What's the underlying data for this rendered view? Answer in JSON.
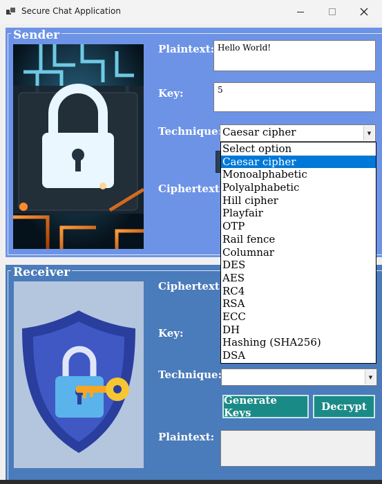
{
  "window": {
    "title": "Secure Chat Application"
  },
  "colors": {
    "sender_bg": "#6d93e6",
    "receiver_bg": "#4a7bba",
    "button_bg": "#1a8a86",
    "selection": "#0078d7"
  },
  "sender": {
    "group_title": "Sender",
    "plaintext_label": "Plaintext:",
    "plaintext_value": "Hello World!",
    "key_label": "Key:",
    "key_value": "5",
    "technique_label": "Technique:",
    "technique_value": "Caesar cipher",
    "ciphertext_label": "Ciphertext:",
    "image_icon": "padlock-circuit-image"
  },
  "dropdown": {
    "options": [
      "Select option",
      "Caesar cipher",
      "Monoalphabetic",
      "Polyalphabetic",
      "Hill cipher",
      "Playfair",
      "OTP",
      "Rail fence",
      "Columnar",
      "DES",
      "AES",
      "RC4",
      "RSA",
      "ECC",
      "DH",
      "Hashing (SHA256)",
      "DSA"
    ],
    "selected": "Caesar cipher"
  },
  "receiver": {
    "group_title": "Receiver",
    "ciphertext_label": "Ciphertext:",
    "key_label": "Key:",
    "technique_label": "Technique:",
    "technique_value": "",
    "generate_keys_label": "Generate Keys",
    "decrypt_label": "Decrypt",
    "plaintext_label": "Plaintext:",
    "plaintext_value": "",
    "image_icon": "shield-lock-key-image"
  }
}
